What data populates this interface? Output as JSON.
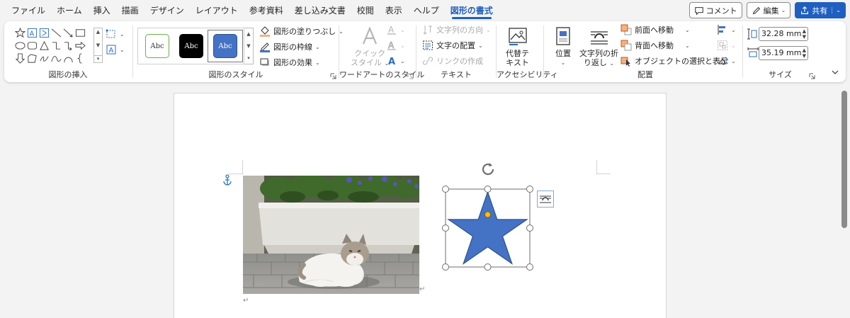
{
  "menu": {
    "tabs": [
      "ファイル",
      "ホーム",
      "挿入",
      "描画",
      "デザイン",
      "レイアウト",
      "参考資料",
      "差し込み文書",
      "校閲",
      "表示",
      "ヘルプ",
      "図形の書式"
    ],
    "active_tab": "図形の書式",
    "comment_label": "コメント",
    "edit_label": "編集",
    "share_label": "共有"
  },
  "ribbon": {
    "insert_shapes": {
      "label": "図形の挿入"
    },
    "shape_styles": {
      "label": "図形のスタイル",
      "gallery": [
        "Abc",
        "Abc",
        "Abc"
      ],
      "fill_label": "図形の塗りつぶし",
      "outline_label": "図形の枠線",
      "effects_label": "図形の効果"
    },
    "wordart": {
      "label": "ワードアートのスタイル",
      "quick_style_line1": "クイック",
      "quick_style_line2": "スタイル"
    },
    "text": {
      "label": "テキスト",
      "direction_label": "文字列の方向",
      "align_label": "文字の配置",
      "link_label": "リンクの作成"
    },
    "accessibility": {
      "label": "アクセシビリティ",
      "alt_text_line1": "代替テ",
      "alt_text_line2": "キスト"
    },
    "arrange": {
      "label": "配置",
      "position_label": "位置",
      "wrap_line1": "文字列の折",
      "wrap_line2": "り返し",
      "bring_forward_label": "前面へ移動",
      "send_backward_label": "背面へ移動",
      "selection_pane_label": "オブジェクトの選択と表示"
    },
    "size": {
      "label": "サイズ",
      "height": "32.28 mm",
      "width": "35.19 mm"
    }
  },
  "colors": {
    "accent": "#1f5fbf",
    "star_fill": "#4472c4",
    "star_stroke": "#2f528f",
    "handle_adjust": "#ffc000"
  },
  "icons": [
    "shape-icons",
    "anchor-icon",
    "rotate-handle-icon",
    "layout-options-icon",
    "cat-photo"
  ]
}
